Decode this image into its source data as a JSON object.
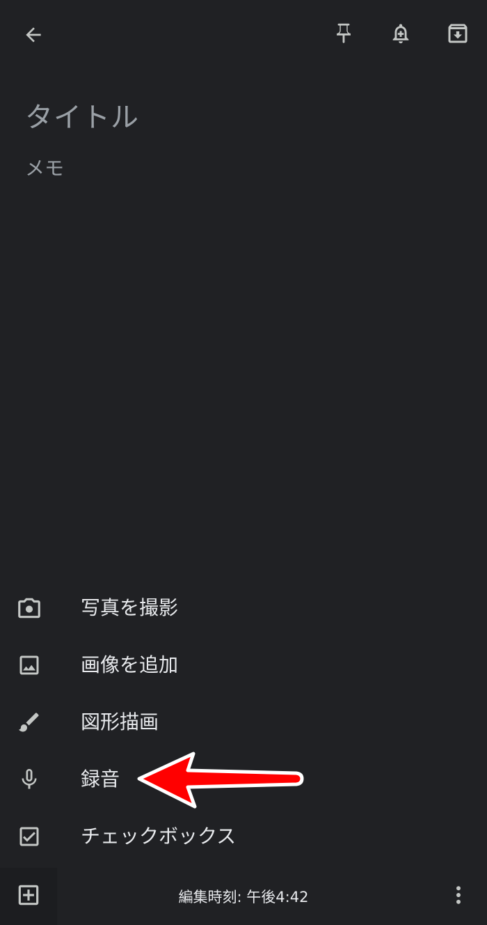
{
  "header": {
    "back_icon": "arrow-left-icon",
    "pin_icon": "pin-icon",
    "reminder_icon": "bell-plus-icon",
    "archive_icon": "archive-icon"
  },
  "note": {
    "title_placeholder": "タイトル",
    "body_placeholder": "メモ"
  },
  "menu": {
    "items": [
      {
        "label": "写真を撮影",
        "icon": "camera-icon"
      },
      {
        "label": "画像を追加",
        "icon": "image-icon"
      },
      {
        "label": "図形描画",
        "icon": "brush-icon"
      },
      {
        "label": "録音",
        "icon": "microphone-icon"
      },
      {
        "label": "チェックボックス",
        "icon": "checkbox-icon"
      }
    ]
  },
  "bottom": {
    "add_icon": "add-box-icon",
    "edit_time": "編集時刻: 午後4:42",
    "more_icon": "more-vert-icon"
  },
  "annotation": {
    "arrow_color": "#ff0000",
    "points_to": "録音"
  },
  "colors": {
    "background": "#202124",
    "icon": "#9aa0a6",
    "text": "#e8eaed"
  }
}
